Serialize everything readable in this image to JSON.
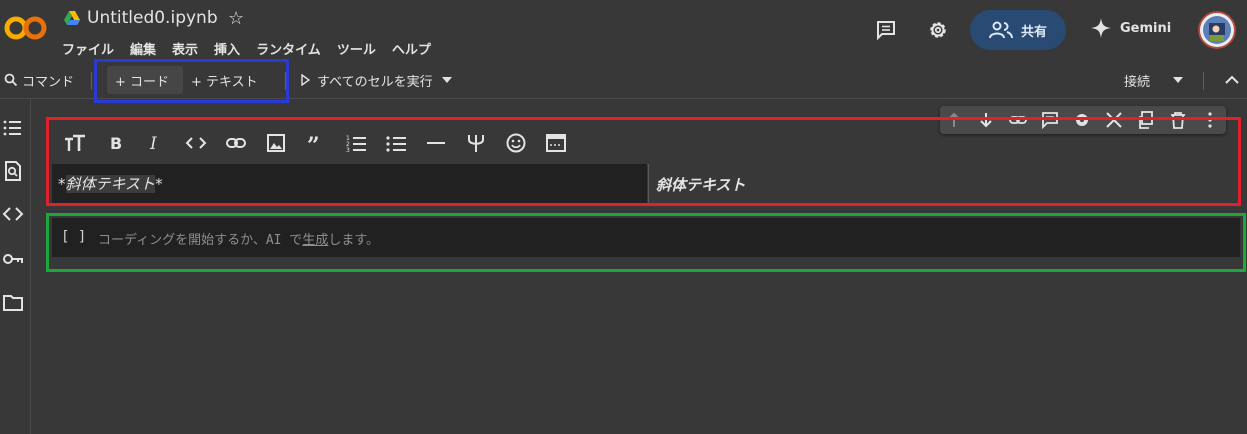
{
  "header": {
    "logo_text": "CO",
    "notebook_title": "Untitled0.ipynb",
    "menu": [
      "ファイル",
      "編集",
      "表示",
      "挿入",
      "ランタイム",
      "ツール",
      "ヘルプ"
    ],
    "share_label": "共有",
    "gemini_label": "Gemini"
  },
  "toolbar": {
    "command_label": "コマンド",
    "add_code_label": "+ コード",
    "add_text_label": "+ テキスト",
    "run_all_label": "すべてのセルを実行",
    "connect_label": "接続"
  },
  "sidebar": {
    "icons": [
      "table-of-contents-icon",
      "find-replace-icon",
      "code-snippets-icon",
      "secrets-key-icon",
      "files-folder-icon"
    ]
  },
  "cell_toolbar": {
    "icons": [
      "move-up-icon",
      "move-down-icon",
      "link-icon",
      "comment-icon",
      "settings-icon",
      "mirror-cell-icon",
      "copy-icon",
      "delete-icon",
      "more-icon"
    ]
  },
  "text_cell": {
    "format_icons": [
      "heading-icon",
      "bold-icon",
      "italic-icon",
      "code-icon",
      "link-icon",
      "image-icon",
      "quote-icon",
      "numbered-list-icon",
      "bulleted-list-icon",
      "horizontal-rule-icon",
      "latex-icon",
      "emoji-icon",
      "table-icon"
    ],
    "source_prefix": "*",
    "source_text": "斜体テキスト",
    "source_suffix": "*",
    "rendered_text": "斜体テキスト"
  },
  "code_cell": {
    "run_indicator": "[ ]",
    "placeholder_before": "コーディングを開始するか、AI で",
    "placeholder_link": "生成",
    "placeholder_after": "します。"
  },
  "colors": {
    "background": "#383838",
    "editor_bg": "#212121",
    "share_bg": "#284a73",
    "annotation_red": "#e0202a",
    "annotation_blue": "#2a3ad6",
    "annotation_green": "#1ca83a"
  }
}
